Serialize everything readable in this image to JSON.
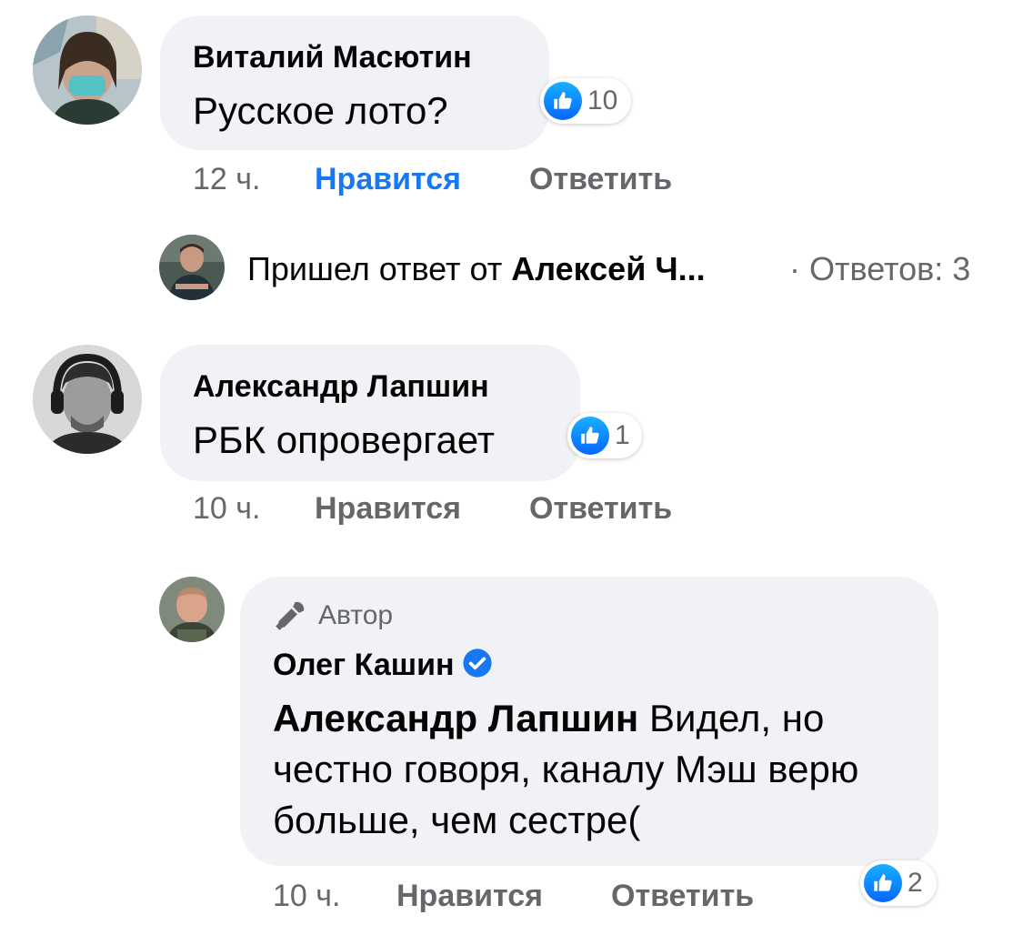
{
  "comments": [
    {
      "author": "Виталий Масютин",
      "text": "Русское лото?",
      "likes": "10",
      "time": "12 ч.",
      "like_label": "Нравится",
      "reply_label": "Ответить",
      "liked": true
    },
    {
      "author": "Александр Лапшин",
      "text": "РБК опровергает",
      "likes": "1",
      "time": "10 ч.",
      "like_label": "Нравится",
      "reply_label": "Ответить",
      "liked": false
    }
  ],
  "reply_summary": {
    "prefix": "Пришел ответ от ",
    "name": "Алексей Ч...",
    "count_text": "· Ответов: 3"
  },
  "author_reply": {
    "badge": "Автор",
    "author": "Олег Кашин",
    "mention": "Александр Лапшин",
    "text": " Видел, но честно говоря, каналу Мэш верю больше, чем сестре(",
    "likes": "2",
    "time": "10 ч.",
    "like_label": "Нравится",
    "reply_label": "Ответить"
  },
  "colors": {
    "accent": "#1877f2",
    "bubble": "#f0f2f5",
    "meta": "#65676b"
  },
  "icons": [
    "like-icon",
    "microphone-icon",
    "verified-badge-icon"
  ]
}
